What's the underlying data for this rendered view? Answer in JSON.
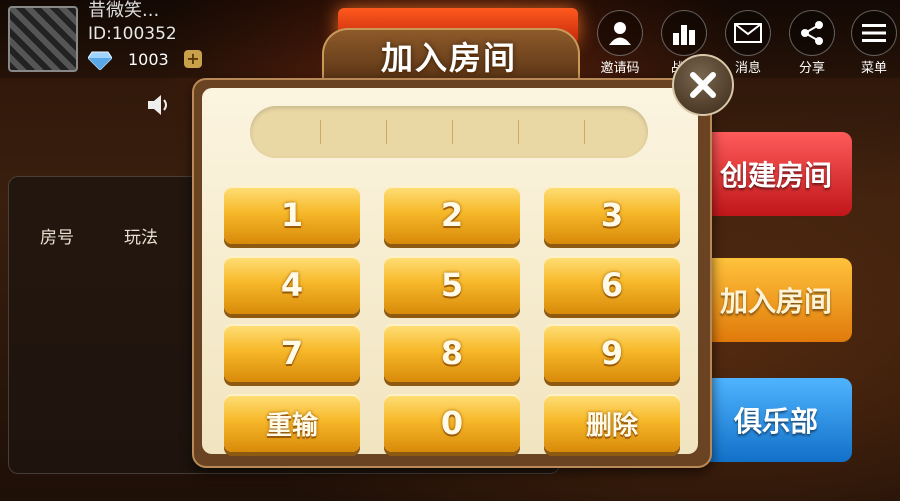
{
  "player": {
    "name": "昔微笑...",
    "id_text": "ID:100352",
    "gems": "1003",
    "plus": "+"
  },
  "top_nav": [
    {
      "label": "邀请码",
      "icon": "user-icon"
    },
    {
      "label": "战绩",
      "icon": "bar-chart-icon"
    },
    {
      "label": "消息",
      "icon": "mail-icon"
    },
    {
      "label": "分享",
      "icon": "share-icon"
    },
    {
      "label": "菜单",
      "icon": "menu-icon"
    }
  ],
  "room_list": {
    "col_room": "房号",
    "col_mode": "玩法"
  },
  "side_buttons": {
    "create": "创建房间",
    "join": "加入房间",
    "club": "俱乐部"
  },
  "dialog": {
    "title": "加入房间",
    "code_value": "",
    "keys": [
      "1",
      "2",
      "3",
      "4",
      "5",
      "6",
      "7",
      "8",
      "9",
      "重输",
      "0",
      "删除"
    ]
  },
  "colors": {
    "key_gold": "#f7b92a",
    "dialog_bg": "#fbf4df",
    "create_red": "#c0161a",
    "join_orange": "#e07a0a",
    "club_blue": "#1270c8"
  }
}
